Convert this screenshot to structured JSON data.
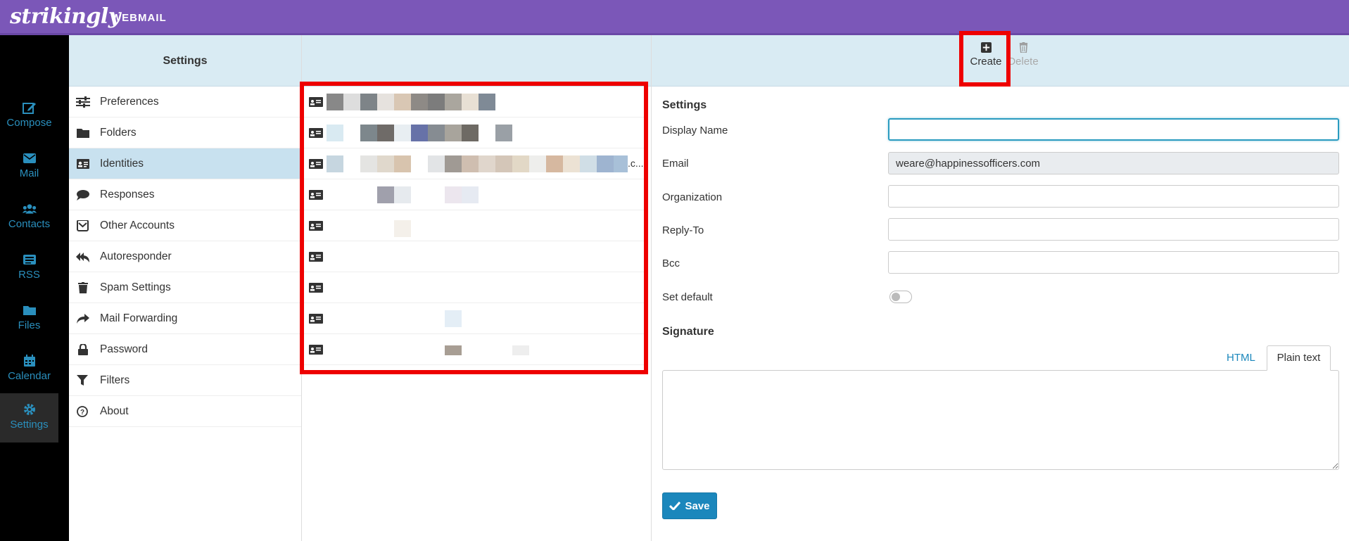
{
  "brand": {
    "logo": "strikingly",
    "product": "WEBMAIL"
  },
  "nav": [
    {
      "label": "Compose",
      "icon": "compose-icon"
    },
    {
      "label": "Mail",
      "icon": "envelope-icon"
    },
    {
      "label": "Contacts",
      "icon": "users-icon"
    },
    {
      "label": "RSS",
      "icon": "rss-icon"
    },
    {
      "label": "Files",
      "icon": "folder-icon"
    },
    {
      "label": "Calendar",
      "icon": "calendar-icon"
    },
    {
      "label": "Settings",
      "icon": "gear-icon",
      "active": true
    }
  ],
  "settings_menu": {
    "title": "Settings",
    "items": [
      {
        "label": "Preferences",
        "icon": "sliders-icon"
      },
      {
        "label": "Folders",
        "icon": "folder-icon"
      },
      {
        "label": "Identities",
        "icon": "id-card-icon",
        "selected": true
      },
      {
        "label": "Responses",
        "icon": "comment-icon"
      },
      {
        "label": "Other Accounts",
        "icon": "envelope-square-icon"
      },
      {
        "label": "Autoresponder",
        "icon": "reply-all-icon"
      },
      {
        "label": "Spam Settings",
        "icon": "trash-icon"
      },
      {
        "label": "Mail Forwarding",
        "icon": "share-icon"
      },
      {
        "label": "Password",
        "icon": "lock-icon"
      },
      {
        "label": "Filters",
        "icon": "filter-icon"
      },
      {
        "label": "About",
        "icon": "question-circle-icon"
      }
    ]
  },
  "identities": {
    "row3_suffix": ".c..."
  },
  "toolbar": {
    "create_label": "Create",
    "delete_label": "Delete"
  },
  "form": {
    "section_title": "Settings",
    "display_name_label": "Display Name",
    "display_name_value": "",
    "email_label": "Email",
    "email_value": "weare@happinessofficers.com",
    "organization_label": "Organization",
    "reply_to_label": "Reply-To",
    "bcc_label": "Bcc",
    "set_default_label": "Set default",
    "signature_title": "Signature",
    "tab_html": "HTML",
    "tab_plain": "Plain text",
    "save_label": "Save"
  },
  "colors": {
    "topbar": "#7b57b8",
    "accent": "#1b87bc",
    "highlight": "#ee0000",
    "selected_row": "#c8e1ef"
  }
}
